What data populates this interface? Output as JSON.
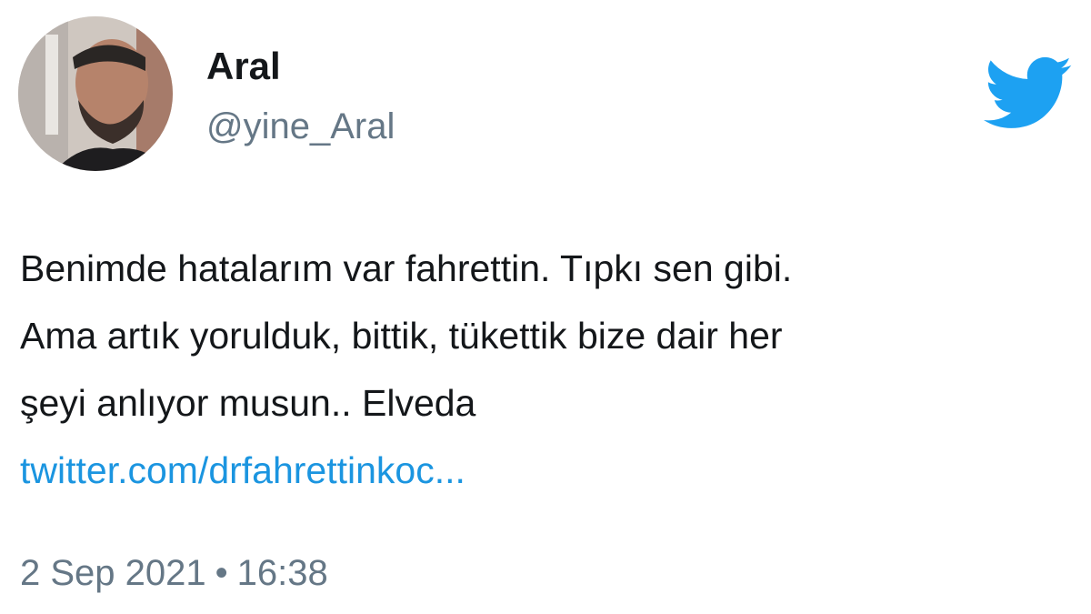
{
  "author": {
    "display_name": "Aral",
    "handle": "@yine_Aral"
  },
  "icons": {
    "brand_logo": "twitter-bird-icon",
    "brand_color": "#1DA1F2"
  },
  "tweet": {
    "text_lines": [
      "Benimde hatalarım var fahrettin. Tıpkı sen gibi.",
      "Ama artık yorulduk, bittik, tükettik bize dair her",
      "şeyi anlıyor musun.. Elveda"
    ],
    "link_text": "twitter.com/drfahrettinkoc...",
    "link_color": "#1B95E0"
  },
  "meta": {
    "date": "2 Sep 2021",
    "separator": "•",
    "time": "16:38"
  }
}
